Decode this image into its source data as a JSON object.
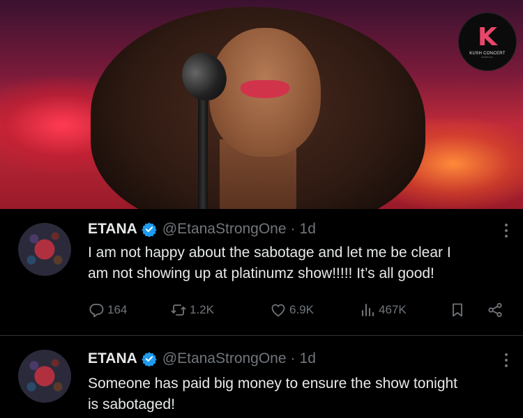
{
  "logo": {
    "letter": "K",
    "brand": "KUSH CONCERT",
    "sub": "AFRICA"
  },
  "tweets": [
    {
      "name": "ETANA",
      "handle": "@EtanaStrongOne",
      "separator": "·",
      "time": "1d",
      "text_line1": "I am not happy about the sabotage and let me be clear I",
      "text_line2": "am not showing up  at platinumz show!!!!! It’s all good!",
      "replies": "164",
      "retweets": "1.2K",
      "likes": "6.9K",
      "views": "467K"
    },
    {
      "name": "ETANA",
      "handle": "@EtanaStrongOne",
      "separator": "·",
      "time": "1d",
      "text_line1": "Someone has paid big money to ensure the show tonight",
      "text_line2": "is sabotaged!"
    }
  ],
  "colors": {
    "background": "#000000",
    "text": "#e7e9ea",
    "muted": "#71767b",
    "verified": "#1d9bf0",
    "logo_accent": "#e9466a"
  },
  "icons": [
    "reply-icon",
    "retweet-icon",
    "like-icon",
    "views-icon",
    "bookmark-icon",
    "share-icon",
    "verified-icon",
    "more-icon"
  ]
}
